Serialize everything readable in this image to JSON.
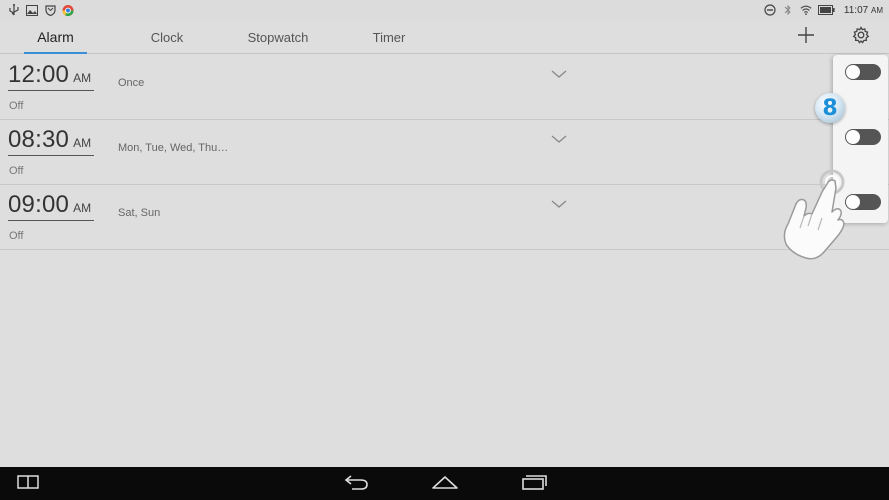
{
  "status_bar": {
    "time": "11:07",
    "ampm": "AM",
    "left_icons": [
      "usb-icon",
      "image-icon",
      "shield-icon",
      "chrome-like-app-icon"
    ],
    "right_icons": [
      "do-not-disturb-icon",
      "bluetooth-icon",
      "wifi-icon",
      "battery-icon"
    ]
  },
  "tabs": [
    {
      "label": "Alarm",
      "active": true
    },
    {
      "label": "Clock",
      "active": false
    },
    {
      "label": "Stopwatch",
      "active": false
    },
    {
      "label": "Timer",
      "active": false
    }
  ],
  "toolbar": {
    "add_icon": "plus-icon",
    "settings_icon": "gear-icon"
  },
  "alarms": [
    {
      "time": "12:00",
      "ampm": "AM",
      "repeat": "Once",
      "state": "Off",
      "enabled": false
    },
    {
      "time": "08:30",
      "ampm": "AM",
      "repeat": "Mon, Tue, Wed, Thu…",
      "state": "Off",
      "enabled": false
    },
    {
      "time": "09:00",
      "ampm": "AM",
      "repeat": "Sat, Sun",
      "state": "Off",
      "enabled": false
    }
  ],
  "tutorial": {
    "step": "8"
  },
  "colors": {
    "accent": "#3b8fd6",
    "background": "#dedede",
    "navbar": "#0a0a0a"
  },
  "nav_bar": {
    "icons": [
      "multi-window-icon",
      "back-icon",
      "home-icon",
      "recents-icon"
    ]
  }
}
